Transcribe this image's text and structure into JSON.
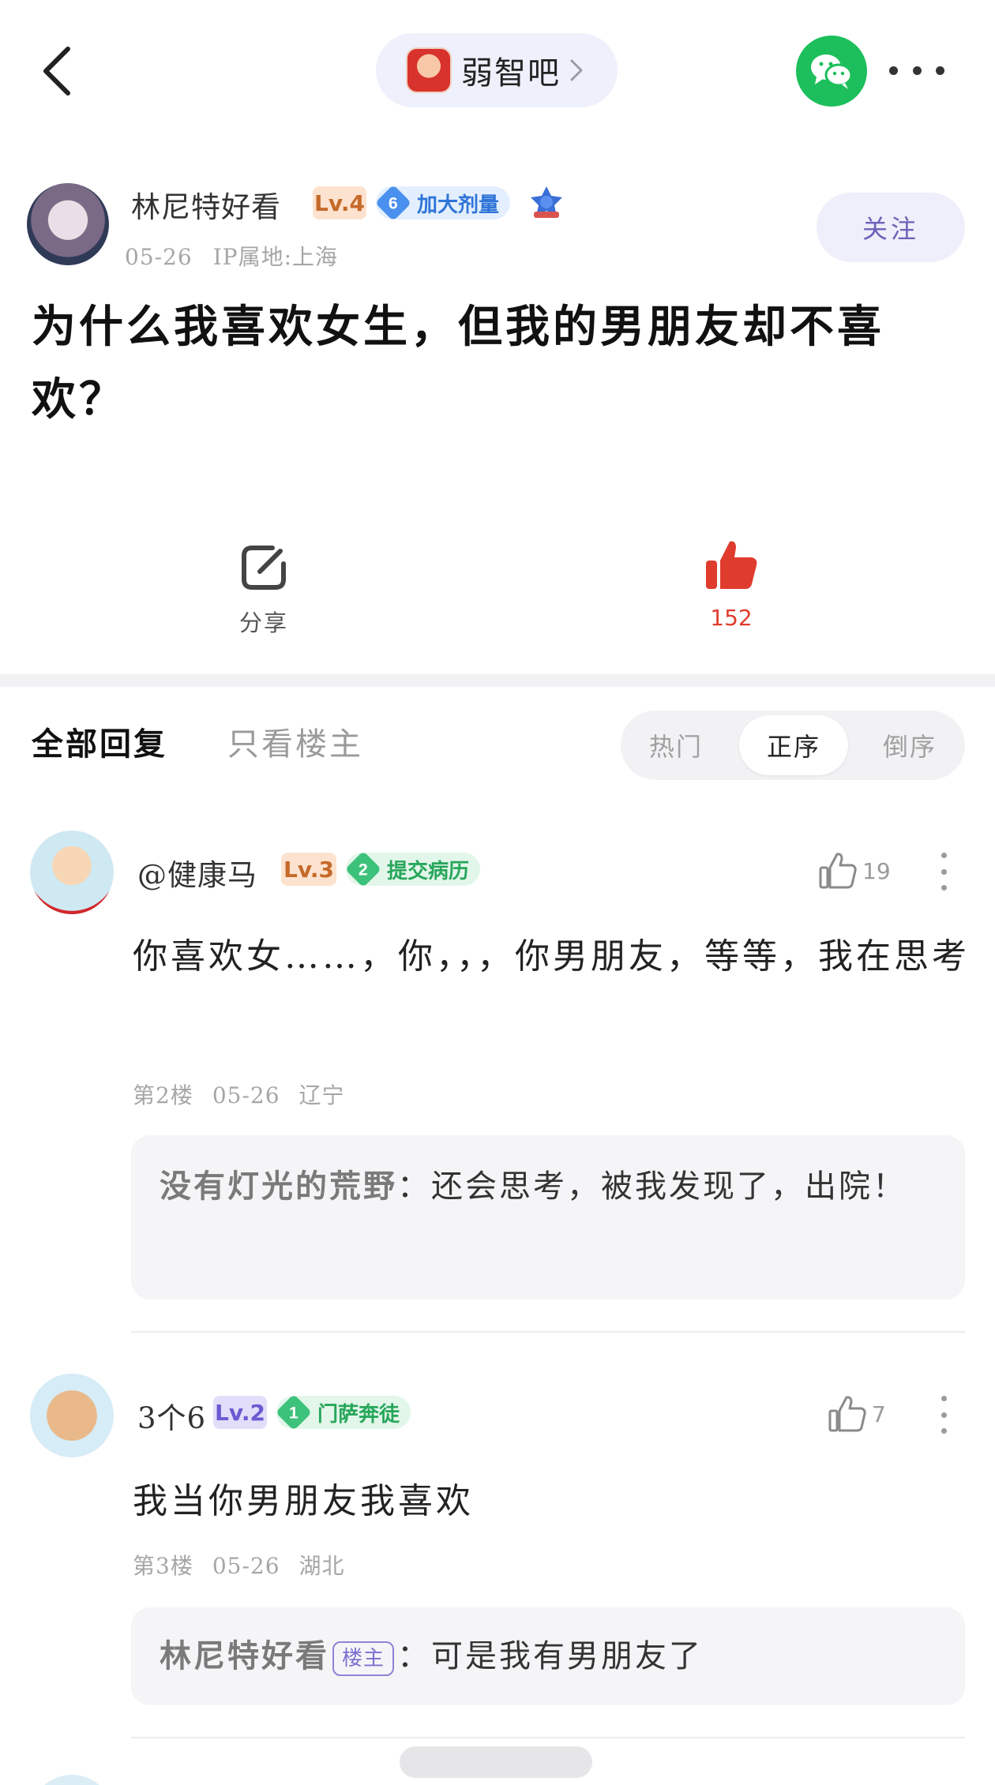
{
  "header": {
    "back_icon": "chevron-left-icon",
    "forum_name": "弱智吧",
    "wechat_icon": "wechat-icon",
    "more_icon": "more-horizontal-icon"
  },
  "post": {
    "author_name": "林尼特好看",
    "level": "Lv.4",
    "title_badge_num": "6",
    "title_badge_text": "加大剂量",
    "date": "05-26",
    "ip": "IP属地:上海",
    "follow_label": "关注",
    "title": "为什么我喜欢女生，但我的男朋友却不喜欢？",
    "share_label": "分享",
    "like_count": "152",
    "accent_color": "#e03c2d"
  },
  "tabs": {
    "all_replies": "全部回复",
    "owner_only": "只看楼主",
    "sort_hot": "热门",
    "sort_asc": "正序",
    "sort_desc": "倒序",
    "active_sort": "正序"
  },
  "replies": [
    {
      "name": "@健康马",
      "level": "Lv.3",
      "badge_num": "2",
      "badge_text": "提交病历",
      "likes": "19",
      "text": "你喜欢女……，你，，，你男朋友，等等，我在思考",
      "floor": "第2楼",
      "date": "05-26",
      "location": "辽宁",
      "sub_reply": {
        "author": "没有灯光的荒野",
        "separator": "：",
        "text": "还会思考，被我发现了，出院！"
      }
    },
    {
      "name": "3个6",
      "level": "Lv.2",
      "badge_num": "1",
      "badge_text": "门萨奔徒",
      "likes": "7",
      "text": "我当你男朋友我喜欢",
      "floor": "第3楼",
      "date": "05-26",
      "location": "湖北",
      "sub_reply": {
        "author": "林尼特好看",
        "owner_tag": "楼主",
        "separator": "：",
        "text": "可是我有男朋友了"
      }
    }
  ]
}
